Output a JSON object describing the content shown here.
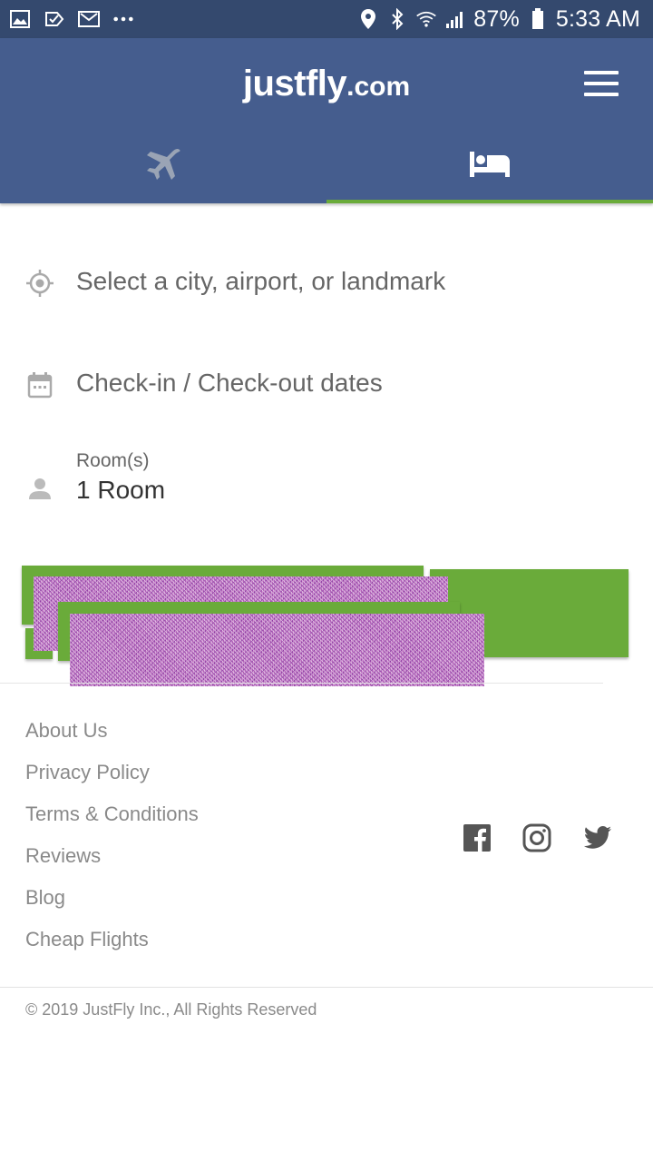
{
  "status_bar": {
    "left_icons": [
      "gallery-icon",
      "check-icon",
      "mail-icon",
      "more-dots-icon"
    ],
    "battery": "87%",
    "time": "5:33 AM"
  },
  "header": {
    "logo_brand": "justfly",
    "logo_tld": ".com",
    "tabs": [
      {
        "name": "flights",
        "icon": "airplane-icon",
        "active": false
      },
      {
        "name": "hotels",
        "icon": "bed-icon",
        "active": true
      }
    ],
    "active_tab_color": "#6aab3a",
    "bg_color": "#455d8e"
  },
  "form": {
    "location_placeholder": "Select a city, airport, or landmark",
    "dates_placeholder": "Check-in / Check-out dates",
    "rooms_label": "Room(s)",
    "rooms_value": "1 Room"
  },
  "search_button": {
    "color": "#6aab3a"
  },
  "footer": {
    "links": [
      "About Us",
      "Privacy Policy",
      "Terms & Conditions",
      "Reviews",
      "Blog",
      "Cheap Flights"
    ],
    "social": [
      "facebook-icon",
      "instagram-icon",
      "twitter-icon"
    ],
    "copyright": "© 2019 JustFly Inc., All Rights Reserved"
  }
}
